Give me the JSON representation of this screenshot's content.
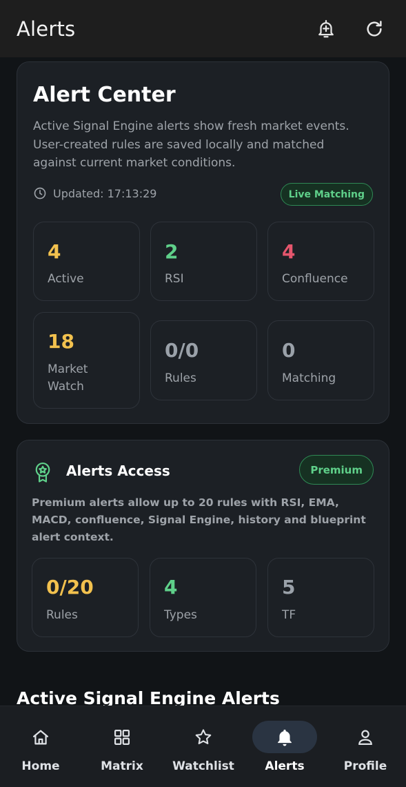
{
  "appbar": {
    "title": "Alerts",
    "actions": [
      {
        "icon": "add-alert-icon"
      },
      {
        "icon": "refresh-icon"
      }
    ]
  },
  "alert_center": {
    "title": "Alert Center",
    "description": "Active Signal Engine alerts show fresh market events. User-created rules are saved locally and matched against current market conditions.",
    "updated_label": "Updated: 17:13:29",
    "badge": "Live Matching",
    "stats": [
      {
        "value": "4",
        "label": "Active",
        "color": "#f2c14e"
      },
      {
        "value": "2",
        "label": "RSI",
        "color": "#5fd08a"
      },
      {
        "value": "4",
        "label": "Confluence",
        "color": "#e5566d"
      },
      {
        "value": "18",
        "label": "Market Watch",
        "color": "#f2c14e"
      },
      {
        "value": "0/0",
        "label": "Rules",
        "color": "#9aa1a9"
      },
      {
        "value": "0",
        "label": "Matching",
        "color": "#9aa1a9"
      }
    ]
  },
  "alerts_access": {
    "icon": "award-icon",
    "title": "Alerts Access",
    "badge": "Premium",
    "description": "Premium alerts allow up to 20 rules with RSI, EMA, MACD, confluence, Signal Engine, history and blueprint alert context.",
    "stats": [
      {
        "value": "0/20",
        "label": "Rules",
        "color": "#f2c14e"
      },
      {
        "value": "4",
        "label": "Types",
        "color": "#5fd08a"
      },
      {
        "value": "5",
        "label": "TF",
        "color": "#9aa1a9"
      }
    ]
  },
  "section_heading": "Active Signal Engine Alerts",
  "bottom_nav": {
    "items": [
      {
        "label": "Home",
        "icon": "home-icon",
        "active": false
      },
      {
        "label": "Matrix",
        "icon": "grid-icon",
        "active": false
      },
      {
        "label": "Watchlist",
        "icon": "star-icon",
        "active": false
      },
      {
        "label": "Alerts",
        "icon": "bell-icon",
        "active": true
      },
      {
        "label": "Profile",
        "icon": "person-icon",
        "active": false
      }
    ]
  }
}
